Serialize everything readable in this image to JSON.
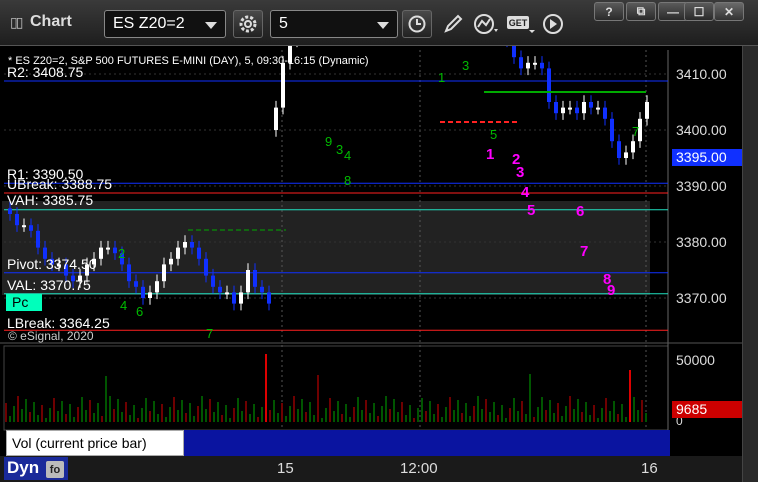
{
  "window": {
    "title": "Chart",
    "symbol": "ES Z20=2",
    "interval": "5",
    "controls": {
      "help": "?",
      "restore": "⧉",
      "minimize": "—",
      "maximize": "☐",
      "close": "✕"
    },
    "toolbar_icons": [
      "settings-gear-icon",
      "clock-icon",
      "pencil-draw-icon",
      "chart-type-icon",
      "get-data-icon",
      "next-arrow-icon"
    ]
  },
  "chart": {
    "subtitle": "* ES Z20=2, S&P 500 FUTURES E-MINI (DAY), 5, 09:30-16:15 (Dynamic)",
    "copyright": "© eSignal, 2020",
    "levels": [
      {
        "label": "R2: 3408.75",
        "value": 3408.75,
        "color": "#1030ff"
      },
      {
        "label": "R1: 3390.50",
        "value": 3390.5,
        "color": "#1030ff"
      },
      {
        "label": "UBreak: 3388.75",
        "value": 3388.75,
        "color": "#ff2020"
      },
      {
        "label": "VAH: 3385.75",
        "value": 3385.75,
        "color": "#20e0c0"
      },
      {
        "label": "Pivot: 3374.50",
        "value": 3374.5,
        "color": "#1030ff"
      },
      {
        "label": "VAL: 3370.75",
        "value": 3370.75,
        "color": "#20e0c0"
      },
      {
        "label": "LBreak: 3364.25",
        "value": 3364.25,
        "color": "#ff2020"
      }
    ],
    "pc_label": "Pc",
    "current_price": "3395.00",
    "current_price_color": "#1030ff",
    "price_axis": [
      "3410.00",
      "3400.00",
      "3390.00",
      "3380.00",
      "3370.00"
    ],
    "price_ticks": [
      3410,
      3400,
      3390,
      3380,
      3370
    ],
    "time_axis": [
      "15",
      "12:00",
      "16"
    ],
    "sequence_labels": [
      "1",
      "2",
      "3",
      "4",
      "5",
      "6",
      "7",
      "8",
      "9"
    ],
    "green_labels": [
      "2",
      "4",
      "6",
      "9",
      "3",
      "4",
      "8",
      "1",
      "3",
      "5",
      "7",
      "7"
    ]
  },
  "volume": {
    "panel_label": "Vol (current price bar)",
    "close_glyph": "×",
    "axis": [
      "50000",
      "0"
    ],
    "current_value": "9685",
    "current_value_color": "#cc0000"
  },
  "status": {
    "mode": "Dyn",
    "mode_icon_text": "fo"
  }
}
